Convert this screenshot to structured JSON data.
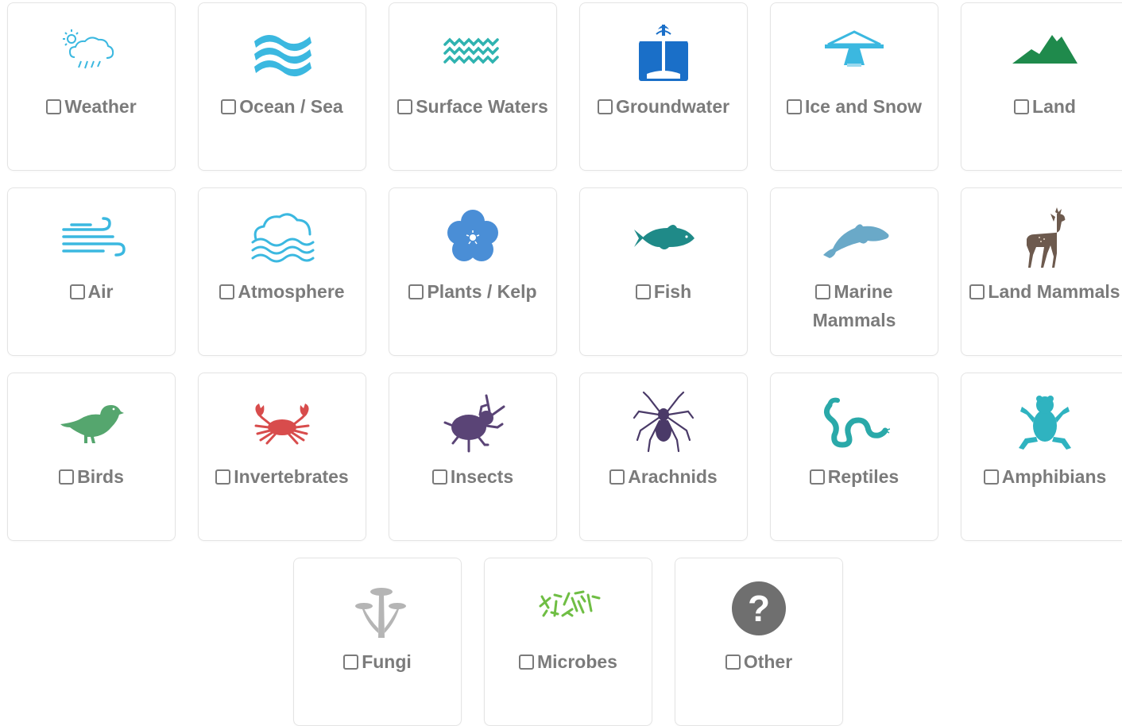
{
  "categories": [
    {
      "label": "Weather",
      "icon": "weather-icon",
      "checked": false
    },
    {
      "label": "Ocean / Sea",
      "icon": "ocean-wave-icon",
      "checked": false
    },
    {
      "label": "Surface Waters",
      "icon": "surface-water-icon",
      "checked": false
    },
    {
      "label": "Groundwater",
      "icon": "groundwater-icon",
      "checked": false
    },
    {
      "label": "Ice and Snow",
      "icon": "ice-snow-icon",
      "checked": false
    },
    {
      "label": "Land",
      "icon": "mountain-icon",
      "checked": false
    },
    {
      "label": "Air",
      "icon": "wind-icon",
      "checked": false
    },
    {
      "label": "Atmosphere",
      "icon": "cloud-waves-icon",
      "checked": false
    },
    {
      "label": "Plants / Kelp",
      "icon": "flower-icon",
      "checked": false
    },
    {
      "label": "Fish",
      "icon": "fish-icon",
      "checked": false
    },
    {
      "label": "Marine Mammals",
      "icon": "dolphin-icon",
      "checked": false
    },
    {
      "label": "Land Mammals",
      "icon": "deer-icon",
      "checked": false
    },
    {
      "label": "Birds",
      "icon": "bird-icon",
      "checked": false
    },
    {
      "label": "Invertebrates",
      "icon": "crab-icon",
      "checked": false
    },
    {
      "label": "Insects",
      "icon": "beetle-icon",
      "checked": false
    },
    {
      "label": "Arachnids",
      "icon": "spider-icon",
      "checked": false
    },
    {
      "label": "Reptiles",
      "icon": "snake-icon",
      "checked": false
    },
    {
      "label": "Amphibians",
      "icon": "frog-icon",
      "checked": false
    },
    {
      "label": "Fungi",
      "icon": "mushroom-icon",
      "checked": false
    },
    {
      "label": "Microbes",
      "icon": "microbes-icon",
      "checked": false
    },
    {
      "label": "Other",
      "icon": "question-mark-icon",
      "checked": false
    }
  ],
  "colors": {
    "label_text": "#7b7b7b",
    "card_border": "#e4e4e4",
    "light_blue": "#3bb8e0",
    "teal": "#2fb3b0",
    "blue": "#1a6fc8",
    "green_land": "#1f8a4c",
    "plant_blue": "#4a8ed6",
    "fish_teal": "#1f8a88",
    "dolphin": "#6aa9c8",
    "deer_brown": "#6d5a4e",
    "bird_green": "#55a66e",
    "crab_red": "#d84c4c",
    "insect_purple": "#5a4476",
    "spider_purple": "#4a3a68",
    "reptile_teal": "#2aa9a9",
    "frog_teal": "#2fb3c0",
    "fungi_gray": "#b5b5b5",
    "microbe_green": "#6fbe44",
    "other_gray": "#6f6f6f"
  }
}
